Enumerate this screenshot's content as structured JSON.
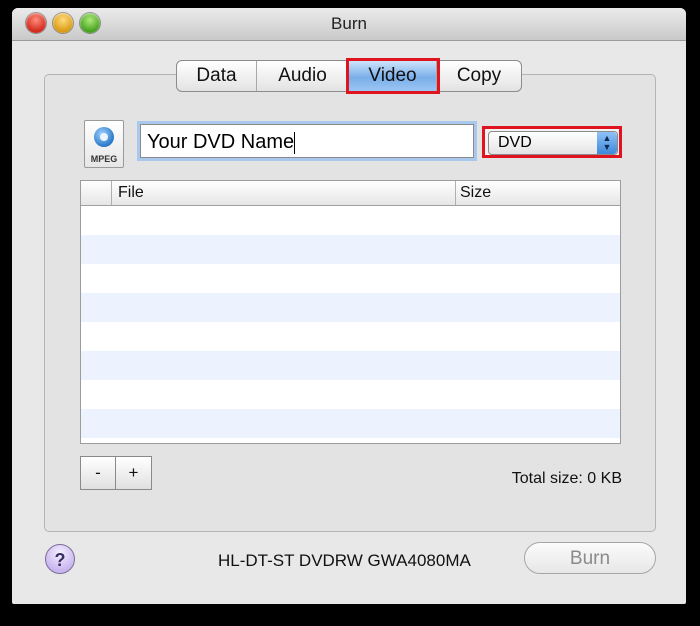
{
  "window": {
    "title": "Burn"
  },
  "tabs": [
    {
      "label": "Data"
    },
    {
      "label": "Audio"
    },
    {
      "label": "Video",
      "selected": true
    },
    {
      "label": "Copy"
    }
  ],
  "file_icon": {
    "label": "MPEG"
  },
  "name_field": {
    "value": "Your DVD Name"
  },
  "format_select": {
    "value": "DVD"
  },
  "table": {
    "columns": [
      "File",
      "Size"
    ],
    "rows": []
  },
  "buttons": {
    "remove": "-",
    "add": "+",
    "help": "?",
    "burn": "Burn"
  },
  "total_size": "Total size: 0 KB",
  "device": "HL-DT-ST DVDRW GWA4080MA",
  "colors": {
    "highlight": "#e0141e",
    "selected_tab": "#79aee9",
    "alt_row": "#edf3fe"
  }
}
